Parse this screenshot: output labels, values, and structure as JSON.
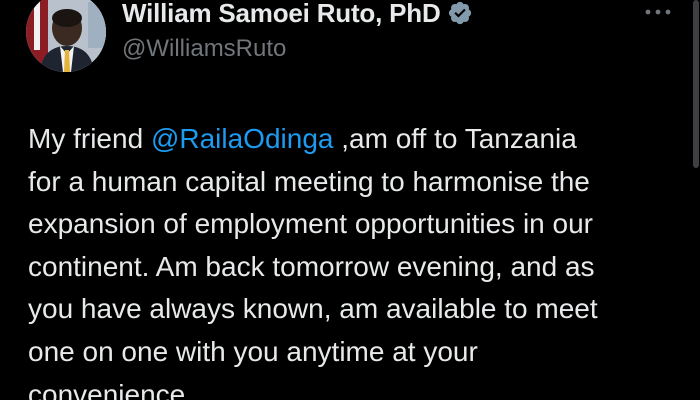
{
  "colors": {
    "background": "#000000",
    "text": "#e7e9ea",
    "secondary_text": "#71767b",
    "mention": "#1d9bf0",
    "verified_badge": "#829aab"
  },
  "author": {
    "display_name": "William Samoei Ruto, PhD",
    "handle": "@WilliamsRuto",
    "verified_icon": "verified-badge-icon",
    "avatar_icon": "profile-photo"
  },
  "more_icon": "more-options-icon",
  "tweet": {
    "lines": [
      {
        "prefix": "My friend ",
        "mention": "@RailaOdinga",
        "suffix": " ,am off to Tanzania"
      },
      {
        "text": "for a human capital meeting to harmonise the"
      },
      {
        "text": "expansion of employment opportunities in our"
      },
      {
        "text": "continent. Am back tomorrow evening, and as"
      },
      {
        "text": "you have always known, am available to meet"
      },
      {
        "text": "one on one with you anytime at your"
      },
      {
        "text": "convenience."
      }
    ]
  }
}
